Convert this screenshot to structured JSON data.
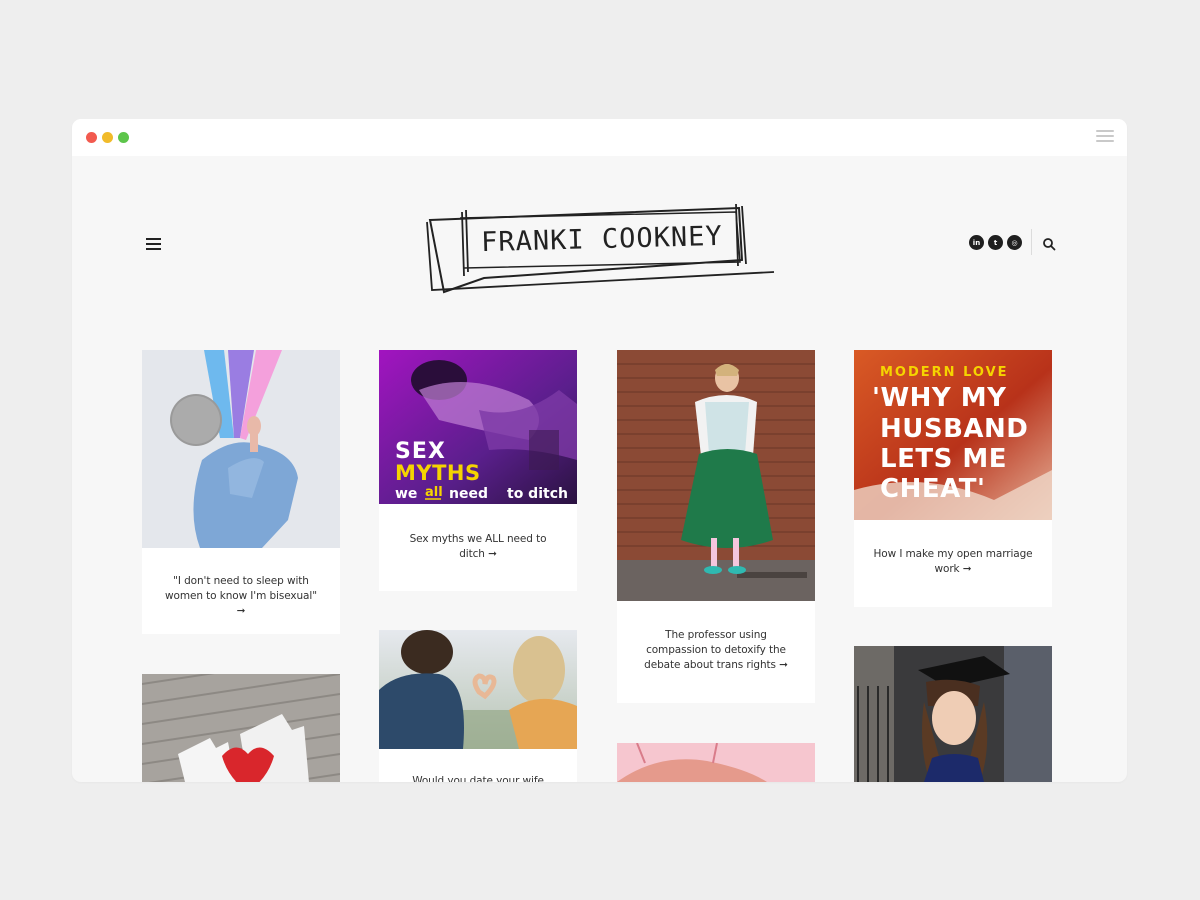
{
  "site": {
    "logo_text": "FRANKI COOKNEY"
  },
  "header": {
    "menu_icon": "hamburger-menu-icon",
    "social": [
      {
        "name": "linkedin",
        "glyph": "in"
      },
      {
        "name": "twitter",
        "glyph": "t"
      },
      {
        "name": "instagram",
        "glyph": "◎"
      }
    ],
    "search_icon": "search-icon"
  },
  "posts": [
    {
      "caption": "\"I don't need to sleep with women to know I'm bisexual\" ➞"
    },
    {
      "caption": "Sex myths we ALL need to ditch ➞",
      "image_text": {
        "line1": "SEX",
        "line2": "MYTHS",
        "line3a": "we",
        "line3b": "all",
        "line3c": "need",
        "line3d": "to ditch"
      }
    },
    {
      "caption": "The professor using compassion to detoxify the debate about trans rights ➞"
    },
    {
      "caption": "How I make my open marriage work ➞",
      "image_text": {
        "kicker": "MODERN LOVE",
        "l1": "'WHY MY",
        "l2": "HUSBAND",
        "l3": "LETS ME",
        "l4": "CHEAT'"
      }
    },
    {
      "caption": ""
    },
    {
      "caption": "Would you date your wife when..."
    },
    {
      "caption": ""
    },
    {
      "caption": ""
    }
  ],
  "colors": {
    "accent_yellow": "#f5d400",
    "text": "#333333",
    "background": "#f7f7f7"
  }
}
